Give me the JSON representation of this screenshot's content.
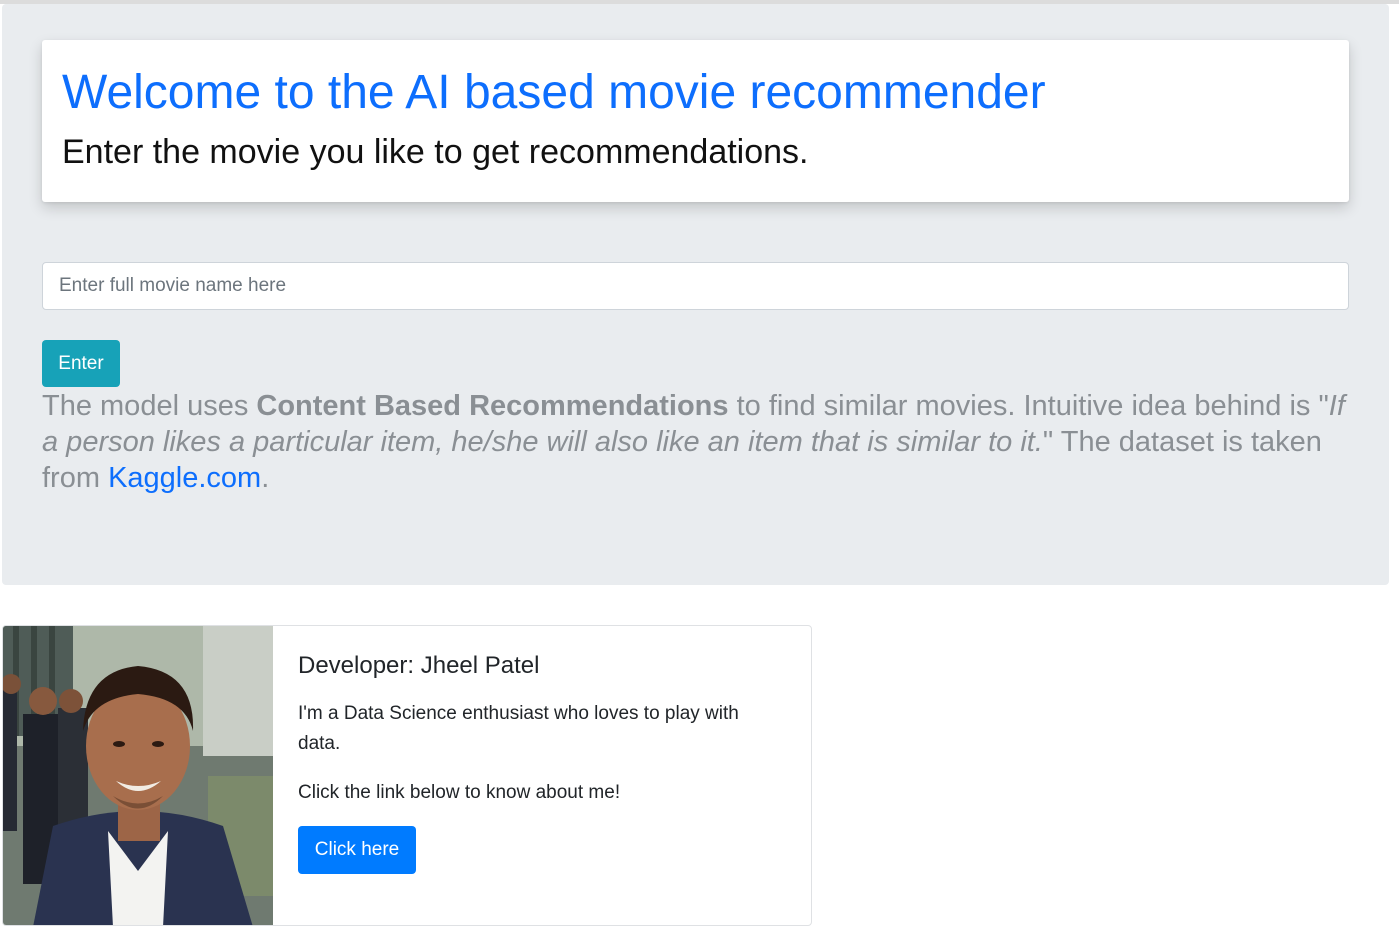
{
  "header": {
    "title": "Welcome to the AI based movie recommender",
    "subtitle": "Enter the movie you like to get recommendations."
  },
  "search": {
    "placeholder": "Enter full movie name here",
    "value": ""
  },
  "enter_button": {
    "label": "Enter"
  },
  "description": {
    "part1": "The model uses ",
    "bold": "Content Based Recommendations",
    "part2": " to find similar movies. Intuitive idea behind is \"",
    "italic": "If a person likes a particular item, he/she will also like an item that is similar to it.",
    "part3": "\" The dataset is taken from ",
    "link_text": "Kaggle.com",
    "part4": "."
  },
  "developer_card": {
    "title": "Developer: Jheel Patel",
    "bio": "I'm a Data Science enthusiast who loves to play with data.",
    "cta": "Click the link below to know about me!",
    "button_label": "Click here"
  },
  "colors": {
    "title_blue": "#0d6efd",
    "jumbotron_bg": "#e9ecef",
    "enter_button_bg": "#17a2b8",
    "click_button_bg": "#007bff",
    "muted_text": "#8a8f94"
  }
}
